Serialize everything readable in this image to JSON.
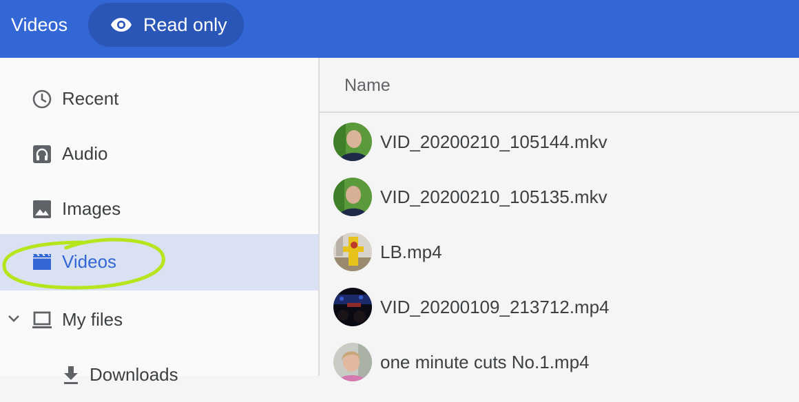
{
  "header": {
    "title": "Videos",
    "read_only_label": "Read only",
    "accent": "#3367d6"
  },
  "sidebar": {
    "items": [
      {
        "label": "Recent",
        "icon": "clock-icon"
      },
      {
        "label": "Audio",
        "icon": "headphones-icon"
      },
      {
        "label": "Images",
        "icon": "image-icon"
      },
      {
        "label": "Videos",
        "icon": "clapperboard-icon",
        "selected": true
      },
      {
        "label": "My files",
        "icon": "laptop-icon",
        "expanded": true
      },
      {
        "label": "Downloads",
        "icon": "download-icon"
      }
    ]
  },
  "file_list": {
    "column_name": "Name",
    "files": [
      {
        "name": "VID_20200210_105144.mkv"
      },
      {
        "name": "VID_20200210_105135.mkv"
      },
      {
        "name": "LB.mp4"
      },
      {
        "name": "VID_20200109_213712.mp4"
      },
      {
        "name": "one minute cuts No.1.mp4"
      }
    ]
  }
}
